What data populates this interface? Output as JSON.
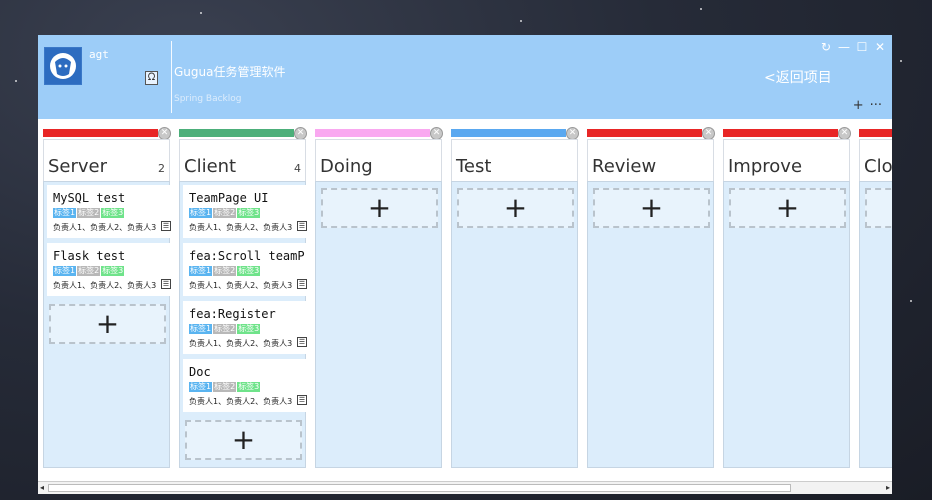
{
  "user": {
    "name": "agt",
    "switch_icon": "user-switch-icon"
  },
  "app": {
    "title": "Gugua任务管理软件",
    "subtitle": "Spring Backlog"
  },
  "window_controls": [
    "↻",
    "—",
    "☐",
    "✕"
  ],
  "header": {
    "back_label": "<返回项目",
    "add_label": "+",
    "more_label": "···"
  },
  "colors": {
    "titlebar": "#9dcdf8",
    "column_body": "#dcedfb",
    "tag_blue": "#5ab4f0",
    "tag_gray": "#b8b8b8",
    "tag_green": "#6fe38a"
  },
  "columns": [
    {
      "title": "Server",
      "count": "2",
      "color": "#e82626",
      "cards": [
        {
          "title": "MySQL test",
          "tags": [
            "标签1",
            "标签2",
            "标签3"
          ],
          "assignees": "负责人1、负责人2、负责人3"
        },
        {
          "title": "Flask test",
          "tags": [
            "标签1",
            "标签2",
            "标签3"
          ],
          "assignees": "负责人1、负责人2、负责人3"
        }
      ]
    },
    {
      "title": "Client",
      "count": "4",
      "color": "#4caf7a",
      "cards": [
        {
          "title": "TeamPage UI",
          "tags": [
            "标签1",
            "标签2",
            "标签3"
          ],
          "assignees": "负责人1、负责人2、负责人3"
        },
        {
          "title": "fea:Scroll teamP",
          "tags": [
            "标签1",
            "标签2",
            "标签3"
          ],
          "assignees": "负责人1、负责人2、负责人3"
        },
        {
          "title": "fea:Register",
          "tags": [
            "标签1",
            "标签2",
            "标签3"
          ],
          "assignees": "负责人1、负责人2、负责人3"
        },
        {
          "title": "Doc",
          "tags": [
            "标签1",
            "标签2",
            "标签3"
          ],
          "assignees": "负责人1、负责人2、负责人3"
        }
      ]
    },
    {
      "title": "Doing",
      "count": "",
      "color": "#f9a8f0",
      "cards": []
    },
    {
      "title": "Test",
      "count": "",
      "color": "#5aa8f0",
      "cards": []
    },
    {
      "title": "Review",
      "count": "",
      "color": "#e82626",
      "cards": []
    },
    {
      "title": "Improve",
      "count": "",
      "color": "#e82626",
      "cards": []
    },
    {
      "title": "Clo",
      "count": "",
      "color": "#e82626",
      "cards": []
    }
  ],
  "add_label": "+",
  "close_glyph": "⊗",
  "card_menu_glyph": "☰",
  "scroll": {
    "left": "◂",
    "right": "▸"
  }
}
